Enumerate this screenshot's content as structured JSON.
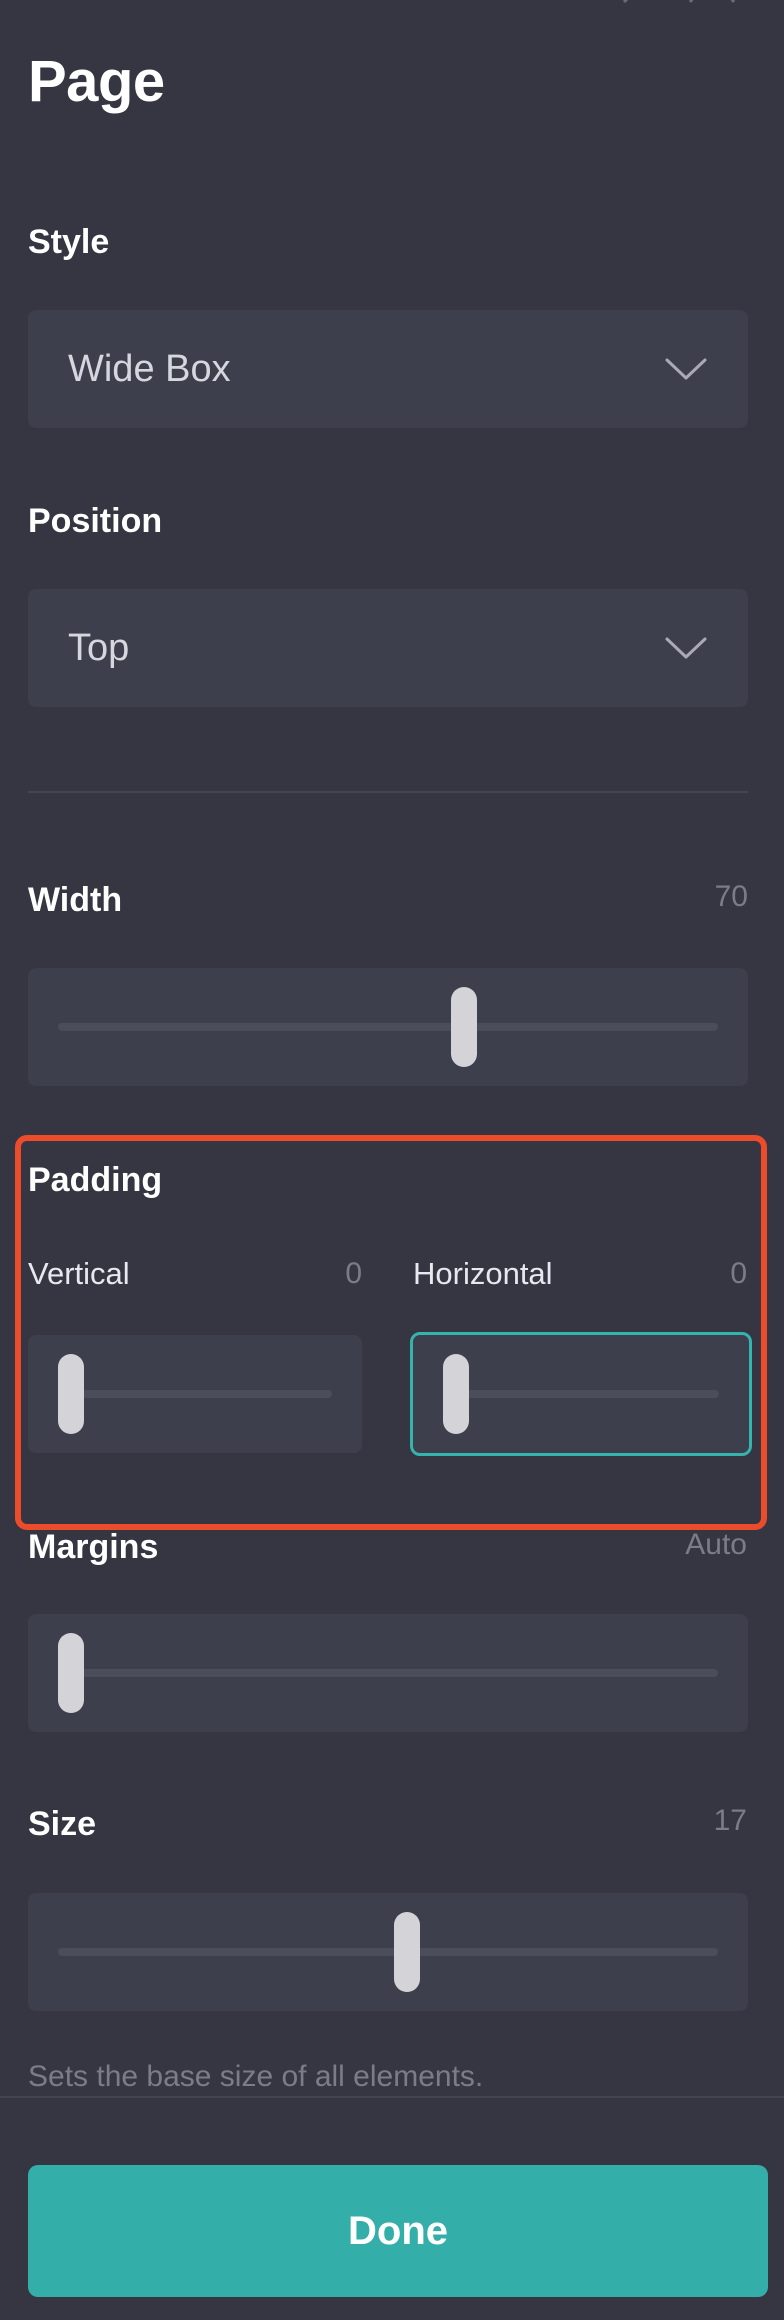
{
  "header": {
    "title": "Page"
  },
  "style_field": {
    "label": "Style",
    "value": "Wide Box"
  },
  "position_field": {
    "label": "Position",
    "value": "Top"
  },
  "width": {
    "label": "Width",
    "value": "70",
    "level": 0.62
  },
  "padding": {
    "label": "Padding",
    "vertical": {
      "label": "Vertical",
      "value": "0",
      "level": 0
    },
    "horizontal": {
      "label": "Horizontal",
      "value": "0",
      "level": 0
    }
  },
  "margins": {
    "label": "Margins",
    "value": "Auto",
    "level": 0
  },
  "size": {
    "label": "Size",
    "value": "17",
    "level": 0.53,
    "helper": "Sets the base size of all elements."
  },
  "footer": {
    "done_label": "Done"
  },
  "colors": {
    "background": "#353641",
    "field": "#3e3f4c",
    "accent": "#33aea9",
    "highlight": "#ec4b2c"
  },
  "icons": {
    "dropdown": "chevron-down-icon"
  }
}
